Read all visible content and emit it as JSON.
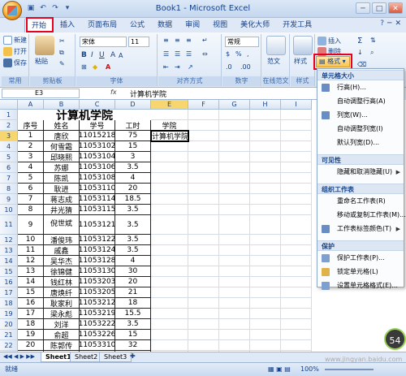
{
  "titlebar": {
    "title": "Book1 - Microsoft Excel",
    "qat_icons": [
      "save-icon",
      "undo-icon",
      "redo-icon",
      "dropdown-icon"
    ],
    "buttons": [
      "─",
      "□",
      "✕"
    ]
  },
  "tabs": [
    "开始",
    "插入",
    "页面布局",
    "公式",
    "数据",
    "审阅",
    "视图",
    "美化大师",
    "开发工具"
  ],
  "ribbon": {
    "clipboard": {
      "label": "剪贴板",
      "paste": "粘贴"
    },
    "common": {
      "label": "常用",
      "new": "新建",
      "open": "打开",
      "save": "保存"
    },
    "font": {
      "label": "字体",
      "name": "宋体",
      "size": "11"
    },
    "alignment": {
      "label": "对齐方式"
    },
    "number": {
      "label": "数字",
      "format": "常规"
    },
    "styles": {
      "label": "样式",
      "style_btn": "样式",
      "fanwen": "范文",
      "fanwen_group": "在线范文"
    },
    "cells": {
      "insert": "插入",
      "delete": "删除",
      "format": "格式"
    }
  },
  "formula_bar": {
    "name_box": "E3",
    "fx": "fx",
    "content": "计算机学院"
  },
  "columns": [
    "A",
    "B",
    "C",
    "D",
    "E",
    "F",
    "G",
    "H",
    "I"
  ],
  "sheet": {
    "title": "计算机学院",
    "headers": [
      "序号",
      "姓名",
      "学号",
      "工时",
      "学院"
    ],
    "rows": [
      [
        "1",
        "唐欣",
        "11015218",
        "75",
        "计算机学院"
      ],
      [
        "2",
        "何雪霜",
        "11053102",
        "15",
        ""
      ],
      [
        "3",
        "邱晓熙",
        "11053104",
        "3",
        ""
      ],
      [
        "4",
        "苏娜",
        "11053106",
        "3.5",
        ""
      ],
      [
        "5",
        "陈凯",
        "11053108",
        "4",
        ""
      ],
      [
        "6",
        "耿进",
        "11053110",
        "20",
        ""
      ],
      [
        "7",
        "蒋志成",
        "11053114",
        "18.5",
        ""
      ],
      [
        "8",
        "井光猜",
        "11053115",
        "3.5",
        ""
      ],
      [
        "9",
        "倪世斌",
        "11053121",
        "3.5",
        ""
      ],
      [
        "10",
        "潘俊玮",
        "11053122",
        "3.5",
        ""
      ],
      [
        "11",
        "戚鑫",
        "11053124",
        "3.5",
        ""
      ],
      [
        "12",
        "吴华杰",
        "11053128",
        "4",
        ""
      ],
      [
        "13",
        "徐锦健",
        "11053130",
        "30",
        ""
      ],
      [
        "14",
        "钱红林",
        "11053203",
        "20",
        ""
      ],
      [
        "15",
        "唐焕纤",
        "11053205",
        "21",
        ""
      ],
      [
        "16",
        "耿家利",
        "11053212",
        "18",
        ""
      ],
      [
        "17",
        "梁永彪",
        "11053219",
        "15.5",
        ""
      ],
      [
        "18",
        "刘洋",
        "11053222",
        "3.5",
        ""
      ],
      [
        "19",
        "俞超",
        "11053226",
        "15",
        ""
      ],
      [
        "20",
        "陈郭传",
        "11053310",
        "32",
        ""
      ],
      [
        "21",
        "金建成",
        "11053316",
        "24",
        ""
      ]
    ]
  },
  "sheet_tabs": [
    "Sheet1",
    "Sheet2",
    "Sheet3"
  ],
  "status": {
    "ready": "就绪",
    "zoom": "100%"
  },
  "menu": {
    "sections": [
      {
        "title": "单元格大小",
        "items": [
          "行高(H)...",
          "自动调整行高(A)",
          "列宽(W)...",
          "自动调整列宽(I)",
          "默认列宽(D)..."
        ]
      },
      {
        "title": "可见性",
        "items": [
          "隐藏和取消隐藏(U)"
        ]
      },
      {
        "title": "组织工作表",
        "items": [
          "重命名工作表(R)",
          "移动或复制工作表(M)...",
          "工作表标签颜色(T)"
        ]
      },
      {
        "title": "保护",
        "items": [
          "保护工作表(P)...",
          "锁定单元格(L)",
          "设置单元格格式(E)..."
        ]
      }
    ]
  },
  "badge": "54",
  "watermark": "www.jingyan.baidu.com",
  "colors": {
    "accent": "#e8001c",
    "ribbon_bg": "#dbe7f5",
    "selected_header": "#f8d66f"
  }
}
